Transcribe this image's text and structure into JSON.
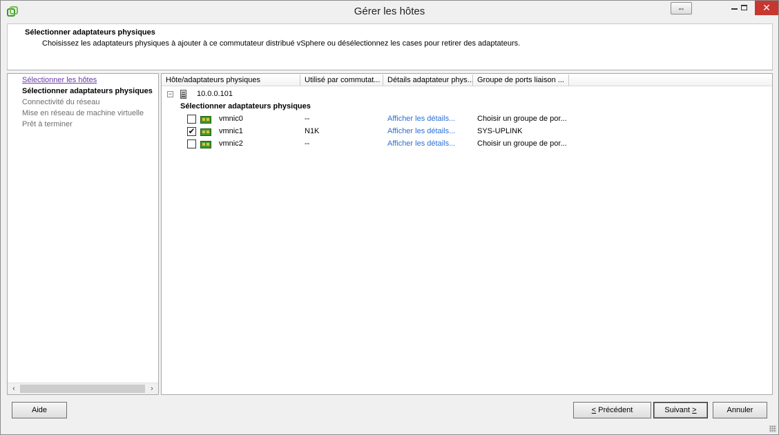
{
  "window": {
    "title": "Gérer les hôtes"
  },
  "header": {
    "title": "Sélectionner adaptateurs physiques",
    "description": "Choisissez les adaptateurs physiques à ajouter à ce commutateur distribué vSphere ou désélectionnez les cases pour retirer des adaptateurs."
  },
  "nav": {
    "items": [
      {
        "label": "Sélectionner les hôtes",
        "state": "link"
      },
      {
        "label": "Sélectionner adaptateurs physiques",
        "state": "current"
      },
      {
        "label": "Connectivité du réseau",
        "state": "disabled"
      },
      {
        "label": "Mise en réseau de machine virtuelle",
        "state": "disabled"
      },
      {
        "label": "Prêt à terminer",
        "state": "disabled"
      }
    ]
  },
  "table": {
    "columns": [
      "Hôte/adaptateurs physiques",
      "Utilisé par commutat...",
      "Détails adaptateur phys...",
      "Groupe de ports liaison ..."
    ],
    "host": "10.0.0.101",
    "group_label": "Sélectionner adaptateurs physiques",
    "rows": [
      {
        "name": "vmnic0",
        "checked": false,
        "used_by": "--",
        "details": "Afficher les détails...",
        "port_group": "Choisir un groupe de por..."
      },
      {
        "name": "vmnic1",
        "checked": true,
        "used_by": "N1K",
        "details": "Afficher les détails...",
        "port_group": "SYS-UPLINK"
      },
      {
        "name": "vmnic2",
        "checked": false,
        "used_by": "--",
        "details": "Afficher les détails...",
        "port_group": "Choisir un groupe de por..."
      }
    ]
  },
  "buttons": {
    "help": "Aide",
    "previous": "Précédent",
    "next": "Suivant",
    "cancel": "Annuler"
  },
  "colors": {
    "link": "#2a6fd6",
    "visited_link": "#6a3aa8",
    "close_button": "#c7372f"
  }
}
